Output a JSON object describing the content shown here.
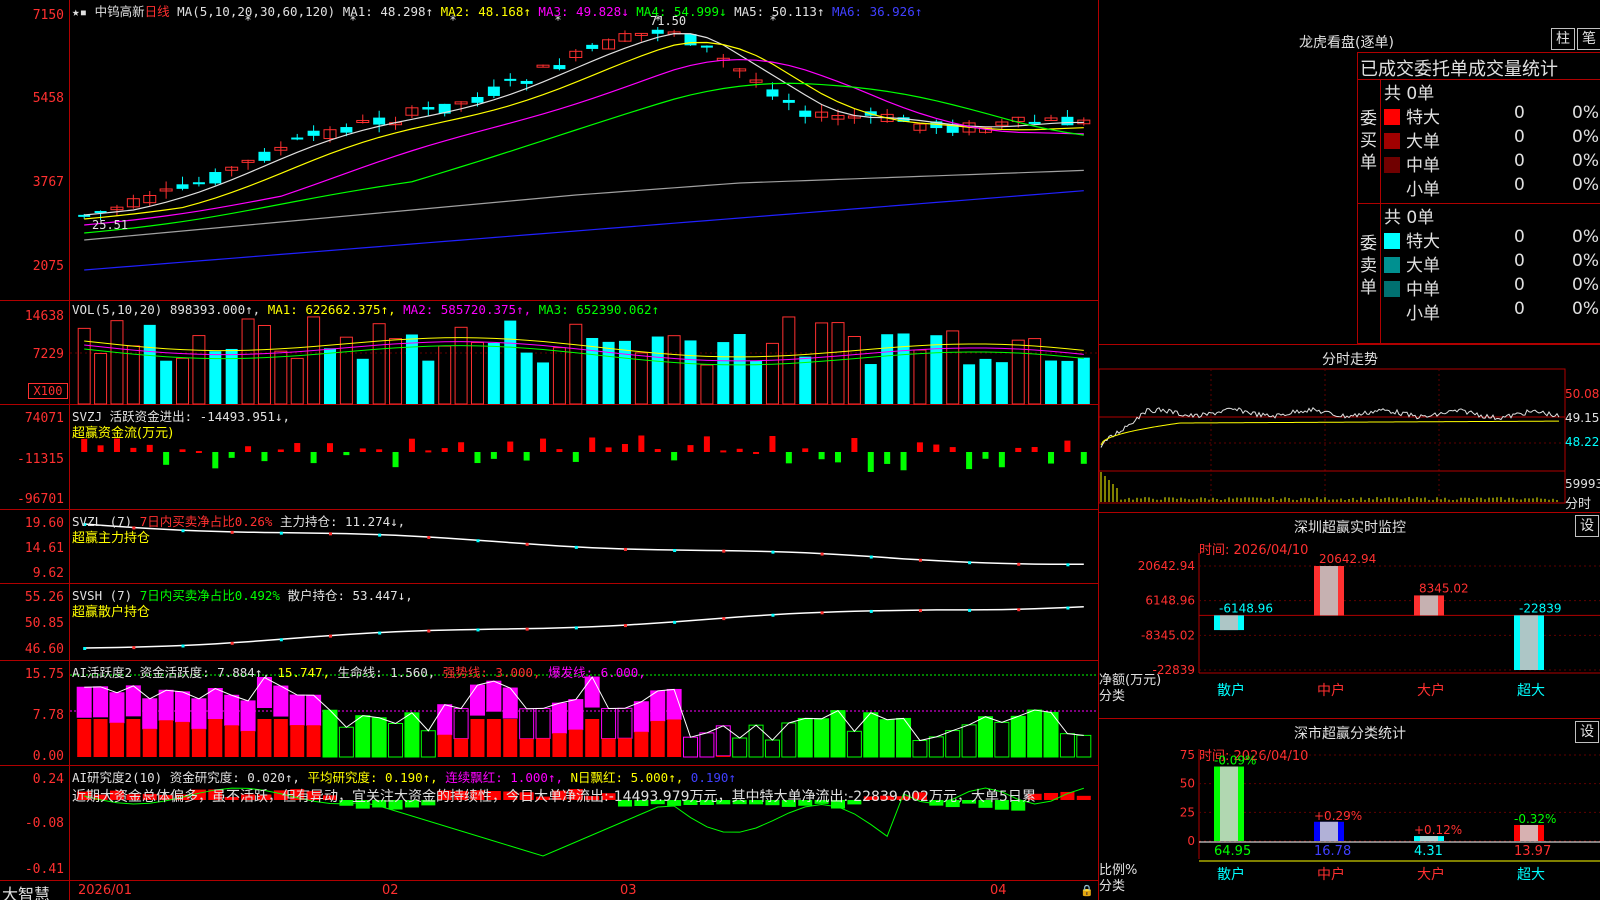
{
  "app": {
    "brand": "大智慧"
  },
  "stock": {
    "name": "中钨高新",
    "period": "日线"
  },
  "main_pane": {
    "ma_params": "MA(5,10,20,30,60,120)",
    "ma1": "MA1: 48.298↑",
    "ma2": "MA2: 48.168↑",
    "ma3": "MA3: 49.828↓",
    "ma4": "MA4: 54.999↓",
    "ma5": "MA5: 50.113↑",
    "ma6": "MA6: 36.926↑",
    "y_ticks": [
      "7150",
      "5458",
      "3767",
      "2075"
    ],
    "high_label": "71.50",
    "low_label": "25.51"
  },
  "vol_pane": {
    "title": "VOL(5,10,20) 898393.000↑,",
    "ma1": "MA1: 622662.375↑,",
    "ma2": "MA2: 585720.375↑,",
    "ma3": "MA3: 652390.062↑",
    "y_ticks": [
      "14638",
      "7229"
    ],
    "unit": "X100"
  },
  "svzj_pane": {
    "title": "SVZJ  活跃资金进出: -14493.951↓,",
    "subtitle": "超赢资金流(万元)",
    "y_ticks": [
      "74071",
      "-11315",
      "-96701"
    ]
  },
  "svzl_pane": {
    "title": "SVZL (7)",
    "net": "7日内买卖净占比0.26%",
    "hold": "主力持仓: 11.274↓,",
    "subtitle": "超赢主力持仓",
    "y_ticks": [
      "19.60",
      "14.61",
      "9.62"
    ]
  },
  "svsh_pane": {
    "title": "SVSH (7)",
    "net": "7日内买卖净占比0.492%",
    "hold": "散户持仓: 53.447↓,",
    "subtitle": "超赢散户持仓",
    "y_ticks": [
      "55.26",
      "50.85",
      "46.60"
    ]
  },
  "ai_active": {
    "title": "AI活跃度2 资金活跃度: 7.884↑,",
    "v2": "15.747,",
    "life": "生命线: 1.560,",
    "strong": "强势线: 3.000,",
    "burst": "爆发线: 6.000,",
    "y_ticks": [
      "15.75",
      "7.78",
      "0.00"
    ]
  },
  "ai_research": {
    "title": "AI研究度2(10) 资金研究度: 0.020↑,",
    "avg": "平均研究度: 0.190↑,",
    "cont": "连续飘红: 1.000↑,",
    "nday": "N日飘红: 5.000↑,",
    "last": "0.190↑",
    "comment": "近期大资金总体偏多，虽不活跃，但有异动，宜关注大资金的持续性，今日大单净流出:-14493.979万元，其中特大单净流出:-22839.002万元，大单5日累",
    "y_ticks": [
      "0.24",
      "-0.08",
      "-0.41"
    ]
  },
  "x_axis": [
    "2026/01",
    "02",
    "03",
    "04"
  ],
  "lhb": {
    "title": "龙虎看盘(逐单)",
    "btn_bar": "柱",
    "btn_pen": "笔",
    "header": "已成交委托单成交量统计",
    "buy_label": "委买单",
    "sell_label": "委卖单",
    "buy_total": "共 0单",
    "sell_total": "共 0单",
    "buy_rows": [
      {
        "name": "特大",
        "vol": "0",
        "pct": "0%",
        "color": "#ff0000"
      },
      {
        "name": "大单",
        "vol": "0",
        "pct": "0%",
        "color": "#a00000"
      },
      {
        "name": "中单",
        "vol": "0",
        "pct": "0%",
        "color": "#700000"
      },
      {
        "name": "小单",
        "vol": "0",
        "pct": "0%",
        "color": ""
      }
    ],
    "sell_rows": [
      {
        "name": "特大",
        "vol": "0",
        "pct": "0%",
        "color": "#00ffff"
      },
      {
        "name": "大单",
        "vol": "0",
        "pct": "0%",
        "color": "#009090"
      },
      {
        "name": "中单",
        "vol": "0",
        "pct": "0%",
        "color": "#007070"
      },
      {
        "name": "小单",
        "vol": "0",
        "pct": "0%",
        "color": ""
      }
    ]
  },
  "intraday": {
    "title": "分时走势",
    "prices": [
      "50.08",
      "49.15",
      "48.22"
    ],
    "vol_label": "59993",
    "unit": "分时"
  },
  "sz_monitor": {
    "title": "深圳超赢实时监控",
    "btn": "设",
    "time": "时间: 2026/04/10",
    "y_ticks": [
      "20642.94",
      "6148.96",
      "-8345.02",
      "-22839"
    ],
    "ylabel": "净额(万元)",
    "xlabel": "分类",
    "categories": [
      "散户",
      "中户",
      "大户",
      "超大"
    ],
    "values": [
      -6148.96,
      20642.94,
      8345.02,
      -22839
    ],
    "value_labels": [
      "-6148.96",
      "20642.94",
      "8345.02",
      "-22839"
    ]
  },
  "sz_class": {
    "title": "深市超赢分类统计",
    "btn": "设",
    "time": "时间: 2026/04/10",
    "y_ticks": [
      "75",
      "50",
      "25",
      "0"
    ],
    "ylabel": "比例%",
    "xlabel": "分类",
    "categories": [
      "散户",
      "中户",
      "大户",
      "超大"
    ],
    "values": [
      64.95,
      16.78,
      4.31,
      13.97
    ],
    "changes": [
      "-0.09%",
      "+0.29%",
      "+0.12%",
      "-0.32%"
    ]
  }
}
